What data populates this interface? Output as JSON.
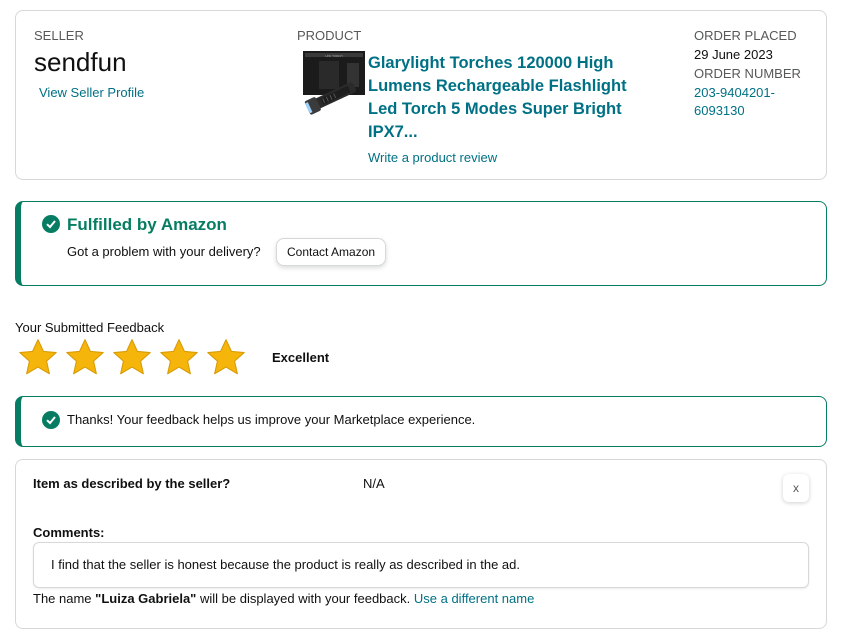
{
  "order": {
    "seller_label": "SELLER",
    "seller_name": "sendfun",
    "view_profile": "View Seller Profile",
    "product_label": "PRODUCT",
    "product_title": "Glarylight Torches 120000 High Lumens Rechargeable Flashlight Led Torch 5 Modes Super Bright IPX7...",
    "write_review": "Write a product review",
    "order_placed_label": "ORDER PLACED",
    "order_placed_value": "29 June 2023",
    "order_number_label": "ORDER NUMBER",
    "order_number_value": "203-9404201-6093130"
  },
  "fulfillment": {
    "title": "Fulfilled by Amazon",
    "question": "Got a problem with your delivery?",
    "contact_button": "Contact Amazon"
  },
  "feedback": {
    "label": "Your Submitted Feedback",
    "rating": 5,
    "rating_max": 5,
    "rating_text": "Excellent",
    "thanks_message": "Thanks! Your feedback helps us improve your Marketplace experience."
  },
  "details": {
    "question": "Item as described by the seller?",
    "answer": "N/A",
    "close_label": "x",
    "comments_label": "Comments:",
    "comment_text": "I find that the seller is honest because the product is really as described in the ad.",
    "name_prefix": "The name ",
    "display_name": "\"Luiza Gabriela\"",
    "name_suffix": " will be displayed with your feedback. ",
    "different_name_link": "Use a different name"
  },
  "colors": {
    "accent_teal": "#067d62",
    "link": "#007185",
    "star": "#f5b50a"
  },
  "icons": [
    "check-circle-icon",
    "star-icon",
    "flashlight-product-image",
    "close-icon"
  ]
}
